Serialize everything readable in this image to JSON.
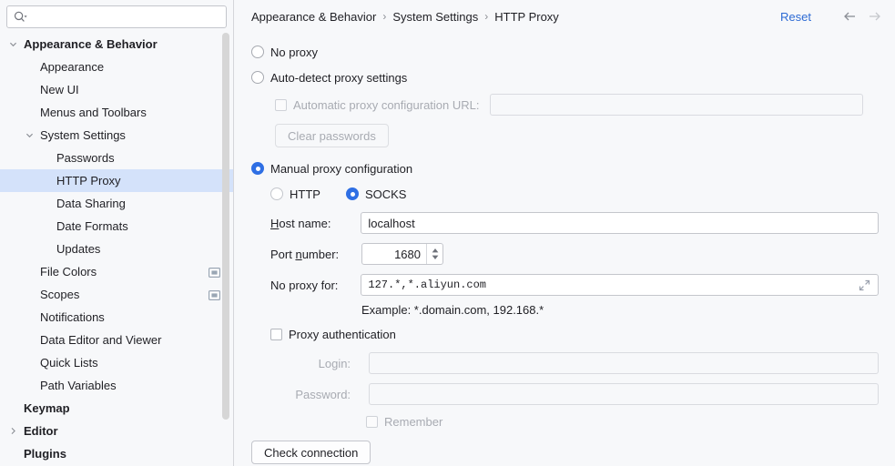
{
  "search": {
    "placeholder": "",
    "value": "",
    "icon": "search-icon"
  },
  "sidebar": {
    "items": [
      {
        "label": "Appearance & Behavior",
        "level": 0,
        "chevron": "chevron-down-icon",
        "selected": false,
        "badge": false
      },
      {
        "label": "Appearance",
        "level": 1,
        "chevron": "none",
        "selected": false,
        "badge": false
      },
      {
        "label": "New UI",
        "level": 1,
        "chevron": "none",
        "selected": false,
        "badge": false
      },
      {
        "label": "Menus and Toolbars",
        "level": 1,
        "chevron": "none",
        "selected": false,
        "badge": false
      },
      {
        "label": "System Settings",
        "level": 1,
        "chevron": "chevron-down-icon",
        "selected": false,
        "badge": false
      },
      {
        "label": "Passwords",
        "level": 2,
        "chevron": "none",
        "selected": false,
        "badge": false
      },
      {
        "label": "HTTP Proxy",
        "level": 2,
        "chevron": "none",
        "selected": true,
        "badge": false
      },
      {
        "label": "Data Sharing",
        "level": 2,
        "chevron": "none",
        "selected": false,
        "badge": false
      },
      {
        "label": "Date Formats",
        "level": 2,
        "chevron": "none",
        "selected": false,
        "badge": false
      },
      {
        "label": "Updates",
        "level": 2,
        "chevron": "none",
        "selected": false,
        "badge": false
      },
      {
        "label": "File Colors",
        "level": 1,
        "chevron": "none",
        "selected": false,
        "badge": true
      },
      {
        "label": "Scopes",
        "level": 1,
        "chevron": "none",
        "selected": false,
        "badge": true
      },
      {
        "label": "Notifications",
        "level": 1,
        "chevron": "none",
        "selected": false,
        "badge": false
      },
      {
        "label": "Data Editor and Viewer",
        "level": 1,
        "chevron": "none",
        "selected": false,
        "badge": false
      },
      {
        "label": "Quick Lists",
        "level": 1,
        "chevron": "none",
        "selected": false,
        "badge": false
      },
      {
        "label": "Path Variables",
        "level": 1,
        "chevron": "none",
        "selected": false,
        "badge": false
      },
      {
        "label": "Keymap",
        "level": 0,
        "chevron": "none",
        "selected": false,
        "badge": false
      },
      {
        "label": "Editor",
        "level": 0,
        "chevron": "chevron-right-icon",
        "selected": false,
        "badge": false
      },
      {
        "label": "Plugins",
        "level": 0,
        "chevron": "none",
        "selected": false,
        "badge": false
      }
    ]
  },
  "header": {
    "breadcrumb": [
      "Appearance & Behavior",
      "System Settings",
      "HTTP Proxy"
    ],
    "separator": "›",
    "reset_label": "Reset",
    "back_icon": "arrow-left-icon",
    "forward_icon": "arrow-right-icon"
  },
  "form": {
    "no_proxy_label": "No proxy",
    "no_proxy_selected": false,
    "auto_detect_label": "Auto-detect proxy settings",
    "auto_detect_selected": false,
    "pac_checkbox_label": "Automatic proxy configuration URL:",
    "pac_checked": false,
    "pac_url_value": "",
    "clear_passwords_label": "Clear passwords",
    "manual_label": "Manual proxy configuration",
    "manual_selected": true,
    "http_label": "HTTP",
    "http_selected": false,
    "socks_label": "SOCKS",
    "socks_selected": true,
    "host_label_pre": "H",
    "host_label_post": "ost name:",
    "host_value": "localhost",
    "port_label_pre": "Port ",
    "port_label_mid": "n",
    "port_label_post": "umber:",
    "port_value": "1680",
    "no_proxy_for_label": "No proxy for:",
    "no_proxy_for_value": "127.*,*.aliyun.com",
    "expand_icon": "expand-diagonal-icon",
    "example_hint": "Example: *.domain.com, 192.168.*",
    "proxy_auth_label": "Proxy authentication",
    "proxy_auth_checked": false,
    "login_label": "Login:",
    "login_value": "",
    "password_label": "Password:",
    "password_value": "",
    "remember_label": "Remember",
    "remember_checked": false,
    "check_connection_label": "Check connection"
  },
  "colors": {
    "accent": "#2f6fe4",
    "link": "#2e6bd4",
    "selection": "#d4e2fa",
    "background": "#f7f8fa",
    "disabled_text": "#a8abb2"
  }
}
